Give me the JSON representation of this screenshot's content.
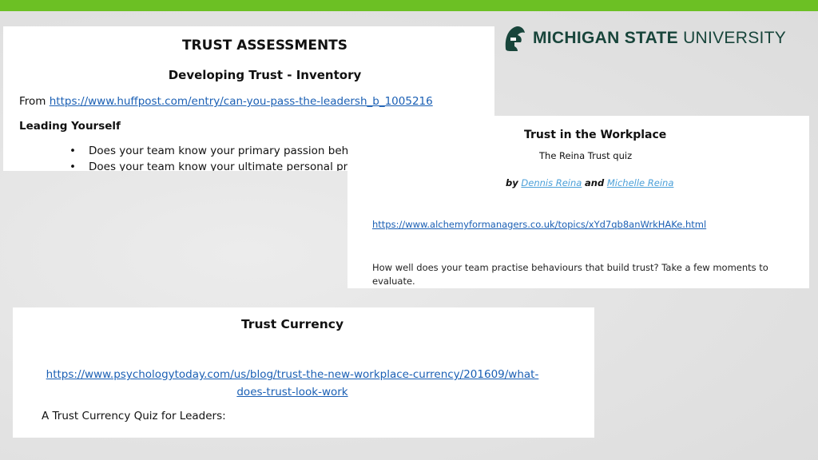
{
  "colors": {
    "accent_bar": "#6cc024",
    "brand_green": "#18453b",
    "link": "#1a5fb4",
    "author_link": "#4a9fd8"
  },
  "logo": {
    "icon": "spartan-helmet-icon",
    "word_bold": "MICHIGAN STATE",
    "word_regular": "UNIVERSITY"
  },
  "inventory": {
    "title": "TRUST ASSESSMENTS",
    "subtitle": "Developing Trust - Inventory",
    "from_label": "From",
    "url": "https://www.huffpost.com/entry/can-you-pass-the-leadersh_b_1005216",
    "section": "Leading Yourself",
    "bullet": "•",
    "items": [
      "Does your team know your primary passion behind the work you do?",
      "Does your team know your ultimate personal professional goal?"
    ]
  },
  "workplace": {
    "title": "Trust in the Workplace",
    "subtitle": "The Reina Trust quiz",
    "by": "by",
    "author1": "Dennis Reina",
    "and": "and",
    "author2": "Michelle Reina",
    "url": "https://www.alchemyformanagers.co.uk/topics/xYd7qb8anWrkHAKe.html",
    "description": "How well does your team practise behaviours that build trust? Take a few moments to evaluate."
  },
  "currency": {
    "title": "Trust Currency",
    "url": "https://www.psychologytoday.com/us/blog/trust-the-new-workplace-currency/201609/what-does-trust-look-work",
    "quiz": "A Trust Currency Quiz for Leaders:"
  }
}
